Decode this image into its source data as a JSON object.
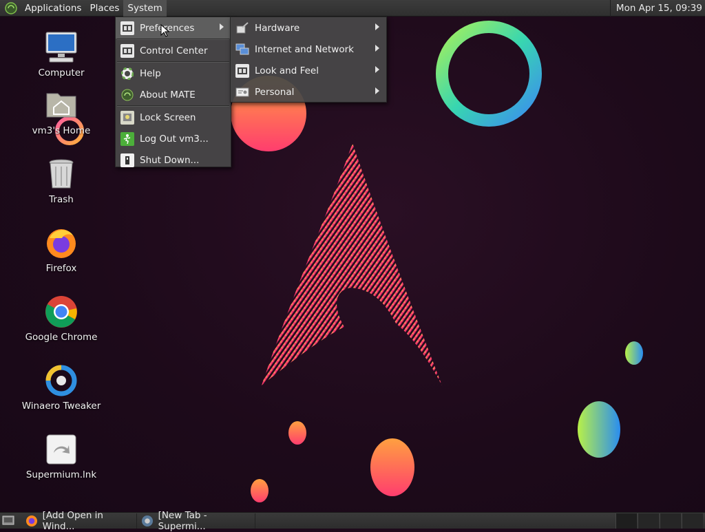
{
  "top_panel": {
    "menus": [
      "Applications",
      "Places",
      "System"
    ],
    "clock": "Mon Apr 15, 09:39"
  },
  "desktop_icons": [
    {
      "label": "Computer",
      "icon": "computer-icon"
    },
    {
      "label": "vm3's Home",
      "icon": "home-folder-icon"
    },
    {
      "label": "Trash",
      "icon": "trash-icon"
    },
    {
      "label": "Firefox",
      "icon": "firefox-icon"
    },
    {
      "label": "Google Chrome",
      "icon": "chrome-icon"
    },
    {
      "label": "Winaero Tweaker",
      "icon": "winaero-tweaker-icon"
    },
    {
      "label": "Supermium.lnk",
      "icon": "supermium-shortcut-icon"
    }
  ],
  "system_menu": {
    "items": [
      {
        "label": "Preferences",
        "icon": "preferences-icon",
        "submenu": true
      },
      {
        "label": "Control Center",
        "icon": "control-center-icon"
      },
      {
        "label": "Help",
        "icon": "help-icon"
      },
      {
        "label": "About MATE",
        "icon": "mate-icon"
      },
      {
        "label": "Lock Screen",
        "icon": "lock-icon"
      },
      {
        "label": "Log Out vm3...",
        "icon": "logout-icon"
      },
      {
        "label": "Shut Down...",
        "icon": "shutdown-icon"
      }
    ]
  },
  "preferences_submenu": {
    "items": [
      {
        "label": "Hardware",
        "icon": "hardware-icon"
      },
      {
        "label": "Internet and Network",
        "icon": "network-icon"
      },
      {
        "label": "Look and Feel",
        "icon": "look-feel-icon"
      },
      {
        "label": "Personal",
        "icon": "personal-icon"
      }
    ]
  },
  "taskbar": {
    "windows": [
      {
        "label": "[Add Open in Wind...",
        "icon": "firefox-icon"
      },
      {
        "label": "[New Tab - Supermi...",
        "icon": "supermium-icon"
      }
    ]
  },
  "colors": {
    "panel": "#333333",
    "menu_bg": "#484848",
    "menu_highlight": "#5e5e5e",
    "wallpaper": "#1d0a1a"
  }
}
